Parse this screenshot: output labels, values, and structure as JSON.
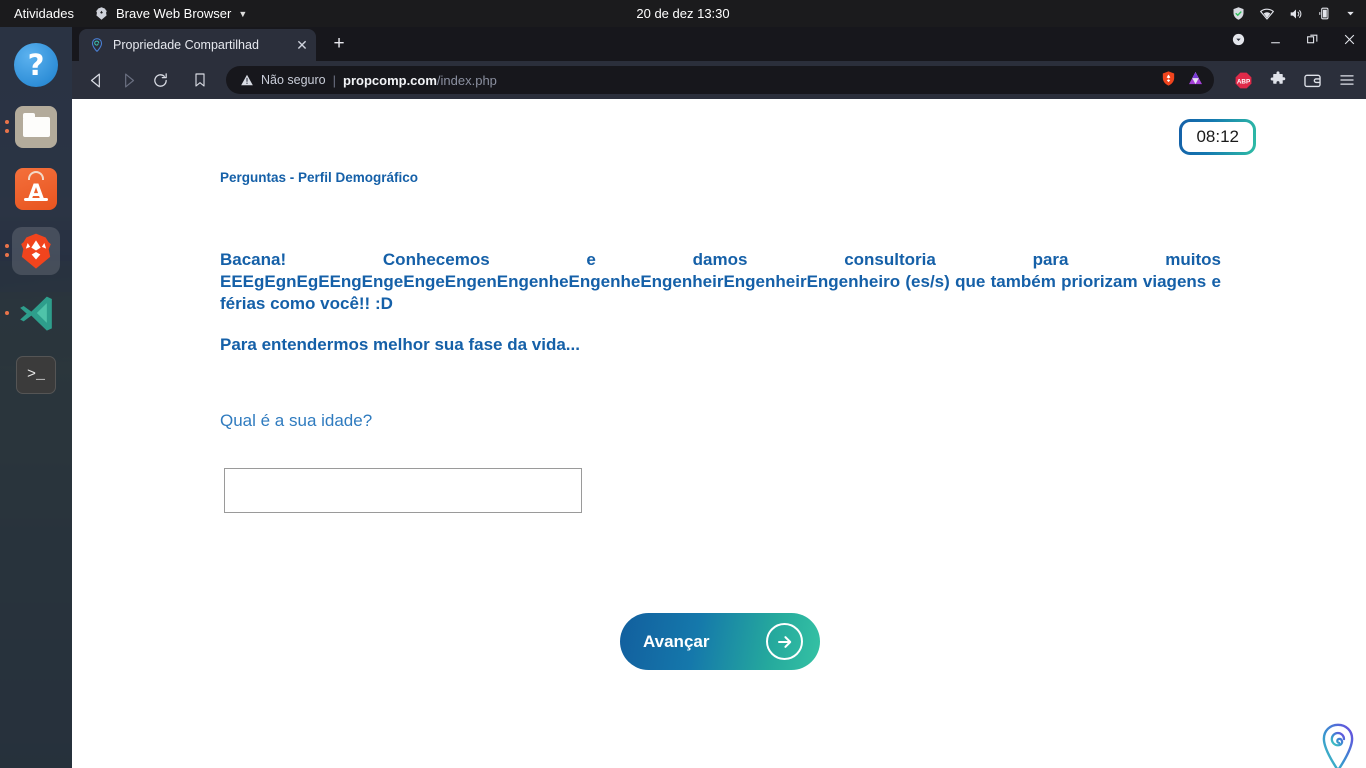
{
  "desktop": {
    "topbar": {
      "activities": "Atividades",
      "app_menu": "Brave Web Browser",
      "app_icon": "brave-lion-icon",
      "caret": "▼",
      "clock": "20 de dez  13:30",
      "tray_icons": [
        "shield-check-icon",
        "wifi-icon",
        "volume-icon",
        "battery-icon",
        "system-menu-caret-icon"
      ]
    },
    "dock": {
      "items": [
        {
          "name": "help",
          "icon": "help-icon",
          "label": "?",
          "running": false
        },
        {
          "name": "files",
          "icon": "files-folder-icon",
          "label": "",
          "running": true
        },
        {
          "name": "ubuntu-software",
          "icon": "software-bag-icon",
          "label": "A",
          "running": false
        },
        {
          "name": "brave-browser",
          "icon": "brave-lion-icon",
          "label": "",
          "running": true
        },
        {
          "name": "vscode",
          "icon": "vscode-icon",
          "label": "",
          "running": true
        },
        {
          "name": "terminal",
          "icon": "terminal-icon",
          "label": ">_",
          "running": false
        }
      ],
      "show_applications": "show-applications-grid-icon"
    }
  },
  "browser": {
    "tab": {
      "title": "Propriedade Compartilhad",
      "favicon": "location-pin-spiral-icon",
      "close": "✕"
    },
    "new_tab": "+",
    "window_controls": {
      "downloads": "downloads-icon",
      "minimize": "minimize-icon",
      "maximize": "maximize-icon",
      "close": "close-icon"
    },
    "nav": {
      "back": "back-arrow-icon",
      "forward": "forward-arrow-icon",
      "reload": "reload-icon",
      "bookmark": "bookmark-icon"
    },
    "omnibox": {
      "security_label": "Não seguro",
      "separator": "|",
      "url_host": "propcomp.com",
      "url_path": "/index.php",
      "shield_icon": "brave-shield-icon",
      "rewards_icon": "brave-rewards-triangle-icon"
    },
    "toolbar_right": {
      "adblock": "ABP",
      "extensions": "extensions-puzzle-icon",
      "wallet": "brave-wallet-icon",
      "menu": "hamburger-menu-icon"
    }
  },
  "page": {
    "timer": "08:12",
    "section_title": "Perguntas - Perfil Demográfico",
    "intro_line1": "Bacana! Conhecemos e damos consultoria para muitos EEEgEgnEgEEngEngeEngeEngenEngenheEngenheEngenheirEngenheirEngenheiro (es/s) que também priorizam viagens e férias como você!! :D",
    "intro_line2": "Para entendermos melhor sua fase da vida...",
    "question_label": "Qual é a sua idade?",
    "answer_value": "",
    "answer_placeholder": "",
    "next_button": "Avançar",
    "next_button_icon": "arrow-right-circle-icon",
    "brand_logo": "location-pin-spiral-logo"
  },
  "colors": {
    "accent_blue": "#1560a8",
    "accent_teal": "#35c2a4",
    "question_blue": "#2f7bbf",
    "topbar_bg": "#1b1b1d",
    "browser_chrome": "#2b2f3b"
  }
}
